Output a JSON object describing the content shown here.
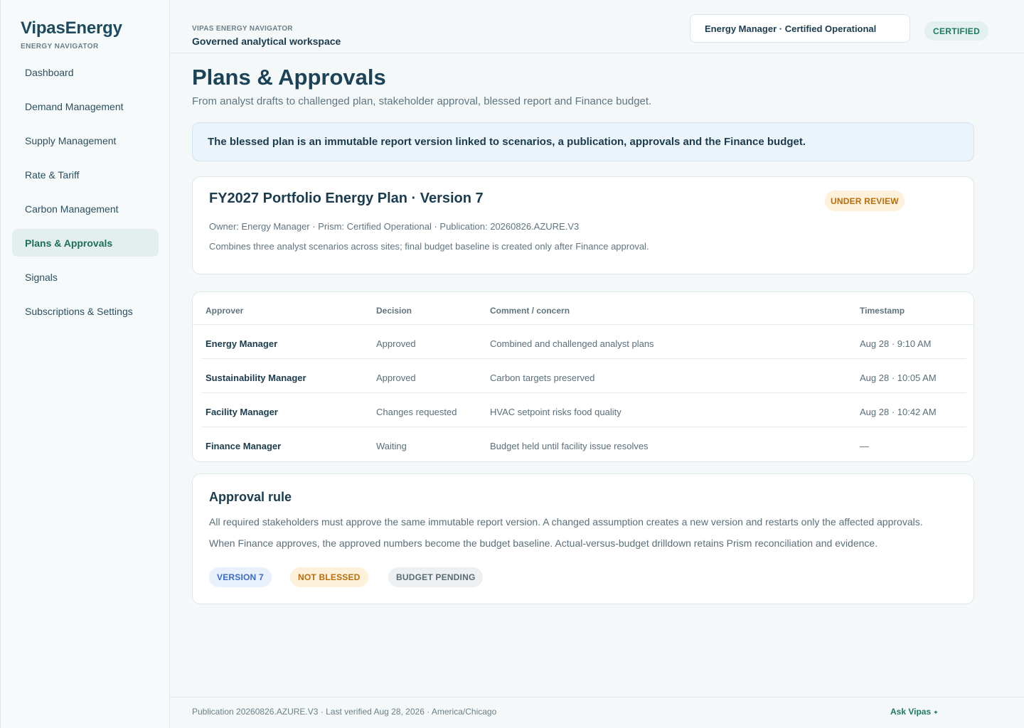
{
  "brand": {
    "name": "VipasEnergy",
    "subtitle": "ENERGY NAVIGATOR"
  },
  "sidebar": {
    "items": [
      {
        "label": "Dashboard",
        "active": false
      },
      {
        "label": "Demand Management",
        "active": false
      },
      {
        "label": "Supply Management",
        "active": false
      },
      {
        "label": "Rate & Tariff",
        "active": false
      },
      {
        "label": "Carbon Management",
        "active": false
      },
      {
        "label": "Plans & Approvals",
        "active": true
      },
      {
        "label": "Signals",
        "active": false
      },
      {
        "label": "Subscriptions & Settings",
        "active": false
      }
    ]
  },
  "topbar": {
    "eyebrow": "VIPAS ENERGY NAVIGATOR",
    "title": "Governed analytical workspace",
    "role": "Energy Manager · Certified Operational",
    "status_badge": "CERTIFIED"
  },
  "page": {
    "title": "Plans & Approvals",
    "subtitle": "From analyst drafts to challenged plan, stakeholder approval, blessed report and Finance budget.",
    "notice": "The blessed plan is an immutable report version linked to scenarios, a publication, approvals and the Finance budget."
  },
  "plan": {
    "title": "FY2027 Portfolio Energy Plan · Version 7",
    "status": "UNDER REVIEW",
    "meta": "Owner: Energy Manager · Prism: Certified Operational · Publication: 20260826.AZURE.V3",
    "description": "Combines three analyst scenarios across sites; final budget baseline is created only after Finance approval."
  },
  "approvals": {
    "columns": [
      "Approver",
      "Decision",
      "Comment / concern",
      "Timestamp"
    ],
    "rows": [
      {
        "approver": "Energy Manager",
        "decision": "Approved",
        "comment": "Combined and challenged analyst plans",
        "timestamp": "Aug 28 · 9:10 AM"
      },
      {
        "approver": "Sustainability Manager",
        "decision": "Approved",
        "comment": "Carbon targets preserved",
        "timestamp": "Aug 28 · 10:05 AM"
      },
      {
        "approver": "Facility Manager",
        "decision": "Changes requested",
        "comment": "HVAC setpoint risks food quality",
        "timestamp": "Aug 28 · 10:42 AM"
      },
      {
        "approver": "Finance Manager",
        "decision": "Waiting",
        "comment": "Budget held until facility issue resolves",
        "timestamp": "—"
      }
    ]
  },
  "rule": {
    "title": "Approval rule",
    "line1": "All required stakeholders must approve the same immutable report version. A changed assumption creates a new version and restarts only the affected approvals.",
    "line2": "When Finance approves, the approved numbers become the budget baseline. Actual-versus-budget drilldown retains Prism reconciliation and evidence.",
    "pills": {
      "version": "VERSION 7",
      "blessed": "NOT BLESSED",
      "budget": "BUDGET PENDING"
    }
  },
  "footer": {
    "text": "Publication 20260826.AZURE.V3 · Last verified Aug 28, 2026 · America/Chicago",
    "ask": "Ask Vipas",
    "ask_icon": "sparkle-icon"
  },
  "colors": {
    "accent_green": "#1f7a63",
    "warning_amber": "#b86e0c",
    "info_blue": "#3a6bc2",
    "text_dark": "#1b3b4e"
  }
}
